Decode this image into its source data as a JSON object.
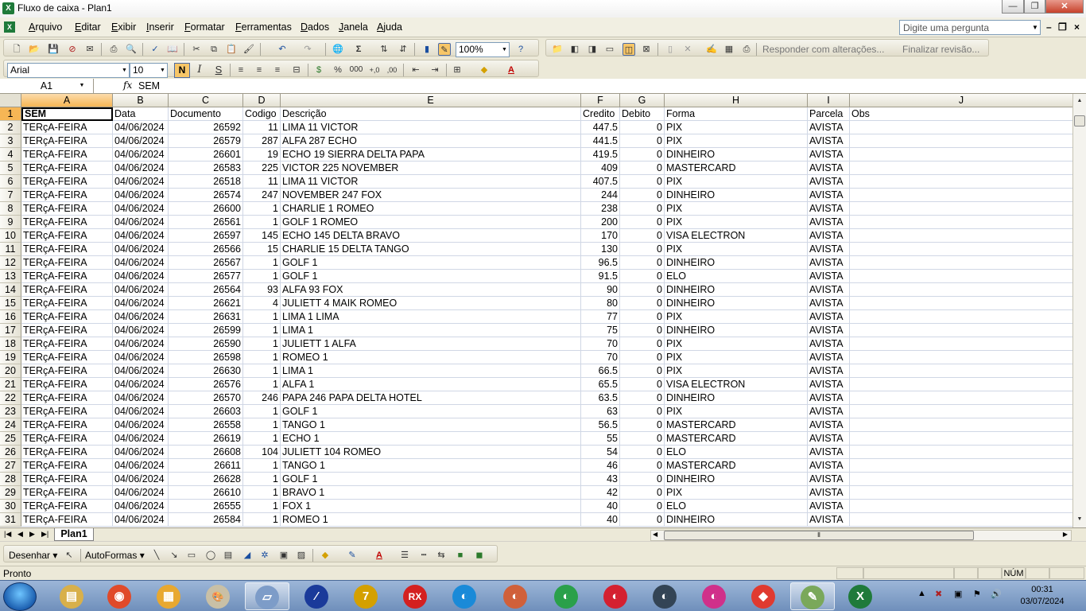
{
  "window": {
    "title": "Fluxo de caixa - Plan1",
    "logo": "X"
  },
  "menu": [
    "Arquivo",
    "Editar",
    "Exibir",
    "Inserir",
    "Formatar",
    "Ferramentas",
    "Dados",
    "Janela",
    "Ajuda"
  ],
  "help_placeholder": "Digite uma pergunta",
  "toolbar": {
    "zoom": "100%",
    "font": "Arial",
    "font_size": "10",
    "bold": "N",
    "italic": "I",
    "underline": "S",
    "percent": "%",
    "thousands": "000",
    "review_reply": "Responder com alterações...",
    "review_end": "Finalizar revisão..."
  },
  "formula": {
    "name_box": "A1",
    "fx": "fx",
    "value": "SEM"
  },
  "columns": [
    "A",
    "B",
    "C",
    "D",
    "E",
    "F",
    "G",
    "H",
    "I",
    "J"
  ],
  "header_row": [
    "SEM",
    "Data",
    "Documento",
    "Codigo",
    "Descrição",
    "Credito",
    "Debito",
    "Forma",
    "Parcela",
    "Obs"
  ],
  "rows": [
    [
      "TERçA-FEIRA",
      "04/06/2024",
      "26592",
      "11",
      "LIMA 11 VICTOR",
      "447.5",
      "0",
      "PIX",
      "AVISTA",
      ""
    ],
    [
      "TERçA-FEIRA",
      "04/06/2024",
      "26579",
      "287",
      "ALFA 287 ECHO",
      "441.5",
      "0",
      "PIX",
      "AVISTA",
      ""
    ],
    [
      "TERçA-FEIRA",
      "04/06/2024",
      "26601",
      "19",
      "ECHO 19 SIERRA DELTA PAPA",
      "419.5",
      "0",
      "DINHEIRO",
      "AVISTA",
      ""
    ],
    [
      "TERçA-FEIRA",
      "04/06/2024",
      "26583",
      "225",
      "VICTOR 225 NOVEMBER",
      "409",
      "0",
      "MASTERCARD",
      "AVISTA",
      ""
    ],
    [
      "TERçA-FEIRA",
      "04/06/2024",
      "26518",
      "11",
      "LIMA 11 VICTOR",
      "407.5",
      "0",
      "PIX",
      "AVISTA",
      ""
    ],
    [
      "TERçA-FEIRA",
      "04/06/2024",
      "26574",
      "247",
      "NOVEMBER 247 FOX",
      "244",
      "0",
      "DINHEIRO",
      "AVISTA",
      ""
    ],
    [
      "TERçA-FEIRA",
      "04/06/2024",
      "26600",
      "1",
      "CHARLIE 1 ROMEO",
      "238",
      "0",
      "PIX",
      "AVISTA",
      ""
    ],
    [
      "TERçA-FEIRA",
      "04/06/2024",
      "26561",
      "1",
      "GOLF 1 ROMEO",
      "200",
      "0",
      "PIX",
      "AVISTA",
      ""
    ],
    [
      "TERçA-FEIRA",
      "04/06/2024",
      "26597",
      "145",
      "ECHO 145 DELTA BRAVO",
      "170",
      "0",
      "VISA ELECTRON",
      "AVISTA",
      ""
    ],
    [
      "TERçA-FEIRA",
      "04/06/2024",
      "26566",
      "15",
      "CHARLIE 15 DELTA TANGO",
      "130",
      "0",
      "PIX",
      "AVISTA",
      ""
    ],
    [
      "TERçA-FEIRA",
      "04/06/2024",
      "26567",
      "1",
      "GOLF 1",
      "96.5",
      "0",
      "DINHEIRO",
      "AVISTA",
      ""
    ],
    [
      "TERçA-FEIRA",
      "04/06/2024",
      "26577",
      "1",
      "GOLF 1",
      "91.5",
      "0",
      "ELO",
      "AVISTA",
      ""
    ],
    [
      "TERçA-FEIRA",
      "04/06/2024",
      "26564",
      "93",
      "ALFA 93 FOX",
      "90",
      "0",
      "DINHEIRO",
      "AVISTA",
      ""
    ],
    [
      "TERçA-FEIRA",
      "04/06/2024",
      "26621",
      "4",
      "JULIETT 4 MAIK ROMEO",
      "80",
      "0",
      "DINHEIRO",
      "AVISTA",
      ""
    ],
    [
      "TERçA-FEIRA",
      "04/06/2024",
      "26631",
      "1",
      "LIMA 1 LIMA",
      "77",
      "0",
      "PIX",
      "AVISTA",
      ""
    ],
    [
      "TERçA-FEIRA",
      "04/06/2024",
      "26599",
      "1",
      "LIMA 1",
      "75",
      "0",
      "DINHEIRO",
      "AVISTA",
      ""
    ],
    [
      "TERçA-FEIRA",
      "04/06/2024",
      "26590",
      "1",
      "JULIETT 1 ALFA",
      "70",
      "0",
      "PIX",
      "AVISTA",
      ""
    ],
    [
      "TERçA-FEIRA",
      "04/06/2024",
      "26598",
      "1",
      "ROMEO 1",
      "70",
      "0",
      "PIX",
      "AVISTA",
      ""
    ],
    [
      "TERçA-FEIRA",
      "04/06/2024",
      "26630",
      "1",
      "LIMA 1",
      "66.5",
      "0",
      "PIX",
      "AVISTA",
      ""
    ],
    [
      "TERçA-FEIRA",
      "04/06/2024",
      "26576",
      "1",
      "ALFA 1",
      "65.5",
      "0",
      "VISA ELECTRON",
      "AVISTA",
      ""
    ],
    [
      "TERçA-FEIRA",
      "04/06/2024",
      "26570",
      "246",
      "PAPA 246 PAPA DELTA HOTEL",
      "63.5",
      "0",
      "DINHEIRO",
      "AVISTA",
      ""
    ],
    [
      "TERçA-FEIRA",
      "04/06/2024",
      "26603",
      "1",
      "GOLF 1",
      "63",
      "0",
      "PIX",
      "AVISTA",
      ""
    ],
    [
      "TERçA-FEIRA",
      "04/06/2024",
      "26558",
      "1",
      "TANGO 1",
      "56.5",
      "0",
      "MASTERCARD",
      "AVISTA",
      ""
    ],
    [
      "TERçA-FEIRA",
      "04/06/2024",
      "26619",
      "1",
      "ECHO 1",
      "55",
      "0",
      "MASTERCARD",
      "AVISTA",
      ""
    ],
    [
      "TERçA-FEIRA",
      "04/06/2024",
      "26608",
      "104",
      "JULIETT 104 ROMEO",
      "54",
      "0",
      "ELO",
      "AVISTA",
      ""
    ],
    [
      "TERçA-FEIRA",
      "04/06/2024",
      "26611",
      "1",
      "TANGO 1",
      "46",
      "0",
      "MASTERCARD",
      "AVISTA",
      ""
    ],
    [
      "TERçA-FEIRA",
      "04/06/2024",
      "26628",
      "1",
      "GOLF 1",
      "43",
      "0",
      "DINHEIRO",
      "AVISTA",
      ""
    ],
    [
      "TERçA-FEIRA",
      "04/06/2024",
      "26610",
      "1",
      "BRAVO 1",
      "42",
      "0",
      "PIX",
      "AVISTA",
      ""
    ],
    [
      "TERçA-FEIRA",
      "04/06/2024",
      "26555",
      "1",
      "FOX 1",
      "40",
      "0",
      "ELO",
      "AVISTA",
      ""
    ],
    [
      "TERçA-FEIRA",
      "04/06/2024",
      "26584",
      "1",
      "ROMEO 1",
      "40",
      "0",
      "DINHEIRO",
      "AVISTA",
      ""
    ]
  ],
  "sheet_tab": "Plan1",
  "drawing": {
    "draw": "Desenhar",
    "autoshapes": "AutoFormas"
  },
  "status": {
    "ready": "Pronto",
    "num": "NÚM"
  },
  "clock": {
    "time": "00:31",
    "date": "03/07/2024"
  },
  "taskbar_apps": [
    "explorer-icon",
    "chrome-icon",
    "folder-icon",
    "paint-icon",
    "notes-icon",
    "app-icon",
    "seven-icon",
    "rx-icon",
    "app-blue-icon",
    "app-orange-icon",
    "app-green-icon",
    "app-red-icon",
    "app-dark-icon",
    "app-pink-icon",
    "app-anydesk-icon",
    "app-paint2-icon",
    "excel-icon"
  ]
}
